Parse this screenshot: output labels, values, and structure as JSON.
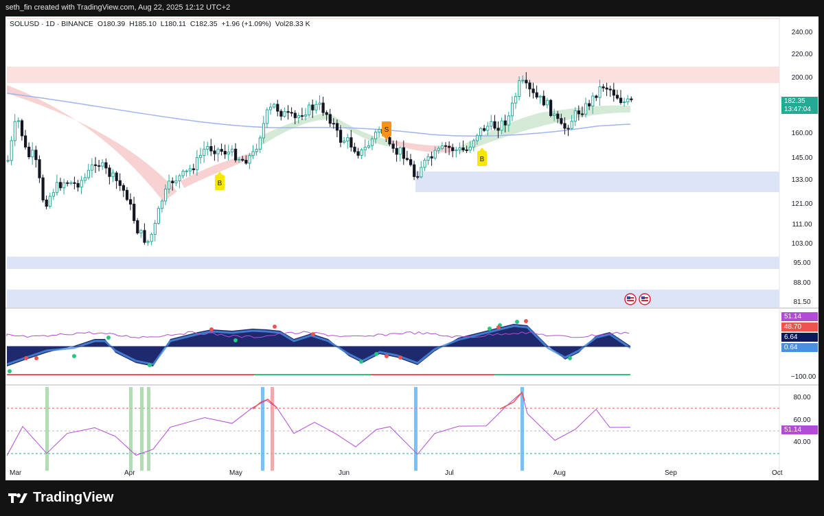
{
  "header": {
    "watermark": "seth_fin created with TradingView.com, Aug 22, 2025 12:12 UTC+2"
  },
  "legend": {
    "symbol": "SOLUSD · 1D · BINANCE",
    "open_label": "O",
    "open": "180.39",
    "high_label": "H",
    "high": "185.10",
    "low_label": "L",
    "low": "180.11",
    "close_label": "C",
    "close": "182.35",
    "change": "+1.96 (+1.09%)",
    "volume_label": "Vol",
    "volume": "28.33 K"
  },
  "price_axis": {
    "ticks": [
      "240.00",
      "220.00",
      "200.00",
      "182.35",
      "160.00",
      "145.00",
      "133.00",
      "121.00",
      "111.00",
      "103.00",
      "95.00",
      "88.00",
      "81.50"
    ]
  },
  "price_tags": {
    "last_price": "182.35",
    "countdown": "13:47:04",
    "last_color": "#22ab94"
  },
  "signals": [
    {
      "label": "B",
      "color": "#f7e600"
    },
    {
      "label": "S",
      "color": "#f7931a"
    },
    {
      "label": "B",
      "color": "#f7e600"
    }
  ],
  "osc_panel": {
    "tags": [
      {
        "text": "51.14",
        "color": "#b44bd6"
      },
      {
        "text": "48.70",
        "color": "#ef5350"
      },
      {
        "text": "6.64",
        "color": "#0c1a5c"
      },
      {
        "text": "0.64",
        "color": "#4a90e2"
      }
    ],
    "bottom_label": "−100.00"
  },
  "rsi_panel": {
    "ticks": [
      "80.00",
      "60.00",
      "40.00"
    ],
    "tag": "51.14",
    "tag_color": "#b44bd6"
  },
  "time_axis": {
    "labels": [
      "Mar",
      "Apr",
      "May",
      "Jun",
      "Jul",
      "Aug",
      "Sep",
      "Oct"
    ]
  },
  "footer": {
    "brand": "TradingView"
  },
  "colors": {
    "up": "#26a69a",
    "down": "#131722",
    "resistance": "#f9d6d6",
    "support": "#d6e0f7",
    "ma_blue": "#9fb4f0"
  }
}
